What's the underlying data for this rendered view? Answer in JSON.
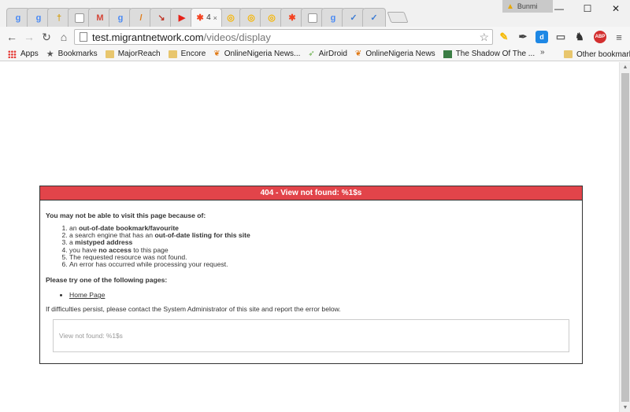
{
  "browser": {
    "tabs": [
      {
        "icon": "google-icon",
        "glyph": "g",
        "color": "#4a8af4"
      },
      {
        "icon": "google-icon",
        "glyph": "g",
        "color": "#4a8af4"
      },
      {
        "icon": "wheat-icon",
        "glyph": "†",
        "color": "#d4a017"
      },
      {
        "icon": "blank-page-icon",
        "glyph": "",
        "color": "#ffffff"
      },
      {
        "icon": "gmail-icon",
        "glyph": "M",
        "color": "#d44638"
      },
      {
        "icon": "google-icon",
        "glyph": "g",
        "color": "#4a8af4"
      },
      {
        "icon": "pen-icon",
        "glyph": "/",
        "color": "#e07a16"
      },
      {
        "icon": "arrow-icon",
        "glyph": "↘",
        "color": "#c0392b"
      },
      {
        "icon": "youtube-icon",
        "glyph": "▶",
        "color": "#e62117"
      },
      {
        "icon": "joomla-icon",
        "glyph": "✱",
        "color": "#f44321",
        "active": true,
        "text": "4",
        "close": "×"
      },
      {
        "icon": "chrome-swirl-icon",
        "glyph": "◎",
        "color": "#f6b400"
      },
      {
        "icon": "chrome-swirl-icon",
        "glyph": "◎",
        "color": "#f6b400"
      },
      {
        "icon": "chrome-swirl-icon",
        "glyph": "◎",
        "color": "#f6b400"
      },
      {
        "icon": "joomla-icon",
        "glyph": "✱",
        "color": "#f44321"
      },
      {
        "icon": "blank-page-icon",
        "glyph": "",
        "color": "#ffffff"
      },
      {
        "icon": "google-icon",
        "glyph": "g",
        "color": "#4a8af4"
      },
      {
        "icon": "check-icon",
        "glyph": "✓",
        "color": "#3b7bd4"
      },
      {
        "icon": "check-icon",
        "glyph": "✓",
        "color": "#3b7bd4"
      }
    ],
    "profile_name": "Bunmi",
    "url_host": "test.migrantnetwork.com",
    "url_path": "/videos/display",
    "extensions": [
      {
        "icon": "note-icon",
        "glyph": "✎",
        "color": "#f5b800"
      },
      {
        "icon": "feather-icon",
        "glyph": "✒",
        "color": "#444444"
      },
      {
        "icon": "pocket-icon",
        "glyph": "d",
        "color": "#1e88e5"
      },
      {
        "icon": "cast-icon",
        "glyph": "▭",
        "color": "#666666"
      },
      {
        "icon": "puzzle-icon",
        "glyph": "♞",
        "color": "#333333"
      },
      {
        "icon": "adblock-icon",
        "glyph": "ABP",
        "color": "#d32f2f"
      },
      {
        "icon": "menu-icon",
        "glyph": "≡",
        "color": "#555555"
      }
    ],
    "bookmarks": [
      {
        "label": "Apps",
        "icon": "apps-icon"
      },
      {
        "label": "Bookmarks",
        "icon": "star-icon"
      },
      {
        "label": "MajorReach",
        "icon": "folder-icon"
      },
      {
        "label": "Encore",
        "icon": "folder-icon"
      },
      {
        "label": "OnlineNigeria News...",
        "icon": "butterfly-icon"
      },
      {
        "label": "AirDroid",
        "icon": "bird-icon"
      },
      {
        "label": "OnlineNigeria News",
        "icon": "butterfly-icon"
      },
      {
        "label": "The Shadow Of The ...",
        "icon": "cube-icon"
      }
    ],
    "bookmarks_overflow": "»",
    "other_bookmarks": "Other bookmarks"
  },
  "page": {
    "title": "404 - View not found: %1$s",
    "lead": "You may not be able to visit this page because of:",
    "reasons": [
      {
        "pre": "an ",
        "bold": "out-of-date bookmark/favourite",
        "post": ""
      },
      {
        "pre": "a search engine that has an ",
        "bold": "out-of-date listing for this site",
        "post": ""
      },
      {
        "pre": "a ",
        "bold": "mistyped address",
        "post": ""
      },
      {
        "pre": "you have ",
        "bold": "no access",
        "post": " to this page"
      },
      {
        "pre": "The requested resource was not found.",
        "bold": "",
        "post": ""
      },
      {
        "pre": "An error has occurred while processing your request.",
        "bold": "",
        "post": ""
      }
    ],
    "try_pages": "Please try one of the following pages:",
    "home_link": "Home Page",
    "difficulties": "If difficulties persist, please contact the System Administrator of this site and report the error below.",
    "error_message": "View not found: %1$s"
  }
}
